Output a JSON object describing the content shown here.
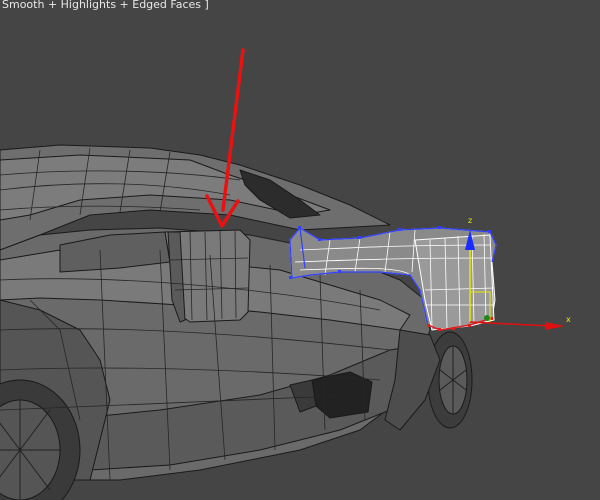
{
  "viewport": {
    "label": "Smooth + Highlights + Edged Faces ]",
    "background": "#454545"
  },
  "gizmo": {
    "z_label": "z",
    "x_label": "x",
    "z_color": "#1a2cff",
    "x_color": "#e01010",
    "y_color": "#1b8a1b"
  },
  "annotation": {
    "arrow_color": "#e81212",
    "icon": "red-arrow-annotation"
  },
  "selection": {
    "wire_color": "#3040ff",
    "vertex_color": "#e02020"
  }
}
